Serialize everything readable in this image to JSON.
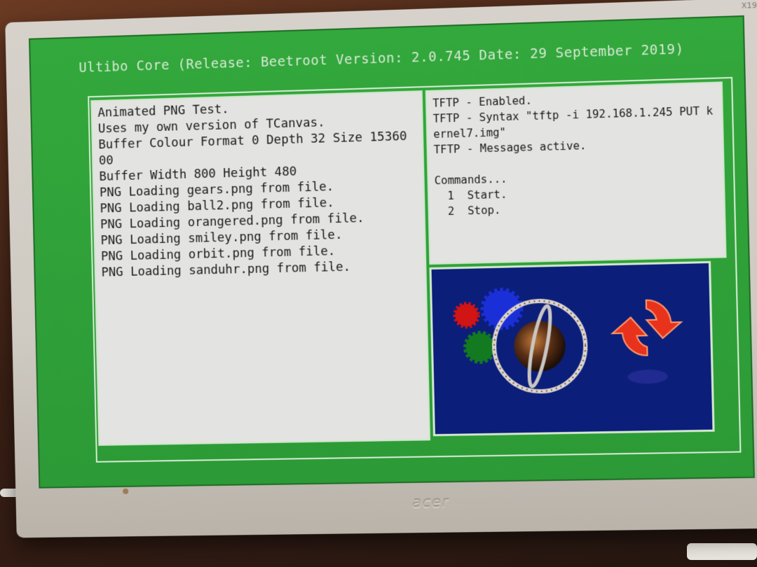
{
  "screen": {
    "title": "Ultibo Core (Release: Beetroot Version: 2.0.745 Date: 29 September 2019)"
  },
  "console": {
    "lines": [
      "Animated PNG Test.",
      "Uses my own version of TCanvas.",
      "Buffer Colour Format 0 Depth 32 Size 15360",
      "00",
      "Buffer Width 800 Height 480",
      "PNG Loading gears.png from file.",
      "PNG Loading ball2.png from file.",
      "PNG Loading orangered.png from file.",
      "PNG Loading smiley.png from file.",
      "PNG Loading orbit.png from file.",
      "PNG Loading sanduhr.png from file."
    ]
  },
  "tftp": {
    "lines": [
      "TFTP - Enabled.",
      "TFTP - Syntax \"tftp -i 192.168.1.245 PUT k",
      "ernel7.img\"",
      "TFTP - Messages active."
    ],
    "commands_title": "Commands...",
    "commands": [
      "1  Start.",
      "2  Stop."
    ]
  },
  "monitor": {
    "brand": "acer",
    "model_label": "X19"
  },
  "colors": {
    "screen_green": "#2f9f3a",
    "panel_grey": "#e3e3e1",
    "animation_blue": "#0b1e7a",
    "bezel": "#d6d2cb"
  },
  "icons": [
    "gears-icon",
    "orbit-ball-icon",
    "orangered-refresh-icon"
  ]
}
